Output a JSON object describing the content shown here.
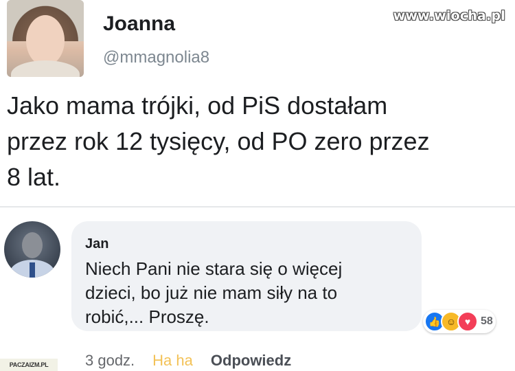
{
  "watermark": "www.wiocha.pl",
  "tweet": {
    "author_name": "Joanna",
    "author_handle": "@mmagnolia8",
    "lines": [
      "Jako mama trójki, od PiS dostałam",
      "przez rok 12 tysięcy, od PO zero przez",
      "8 lat."
    ]
  },
  "comment": {
    "author_name": "Jan",
    "lines": [
      "Niech Pani nie stara się o więcej",
      "dzieci, bo już nie mam siły na to",
      "robić,... Proszę."
    ],
    "reactions": {
      "icons": [
        "like-icon",
        "haha-icon",
        "love-icon"
      ],
      "count": "58"
    },
    "actions": {
      "time": "3 godz.",
      "haha": "Ha ha",
      "reply": "Odpowiedz"
    }
  },
  "site_badge": "PACZAIZM.PL",
  "colors": {
    "like": "#1877f2",
    "haha": "#f7b928",
    "love": "#f33e58",
    "bubble": "#f0f2f5"
  }
}
